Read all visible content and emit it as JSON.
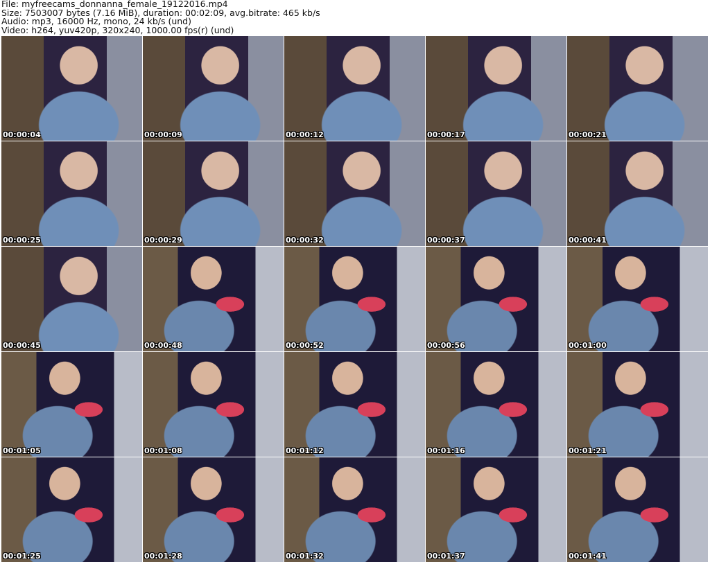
{
  "header": {
    "file": "File: myfreecams_donnanna_female_19122016.mp4",
    "size": "Size: 7503007 bytes (7.16 MiB), duration: 00:02:09, avg.bitrate: 465 kb/s",
    "audio": "Audio: mp3, 16000 Hz, mono, 24 kb/s (und)",
    "video": "Video: h264, yuv420p, 320x240, 1000.00 fps(r) (und)"
  },
  "thumbnails": [
    "00:00:04",
    "00:00:09",
    "00:00:12",
    "00:00:17",
    "00:00:21",
    "00:00:25",
    "00:00:29",
    "00:00:32",
    "00:00:37",
    "00:00:41",
    "00:00:45",
    "00:00:48",
    "00:00:52",
    "00:00:56",
    "00:01:00",
    "00:01:05",
    "00:01:08",
    "00:01:12",
    "00:01:16",
    "00:01:21",
    "00:01:25",
    "00:01:28",
    "00:01:32",
    "00:01:37",
    "00:01:41"
  ]
}
